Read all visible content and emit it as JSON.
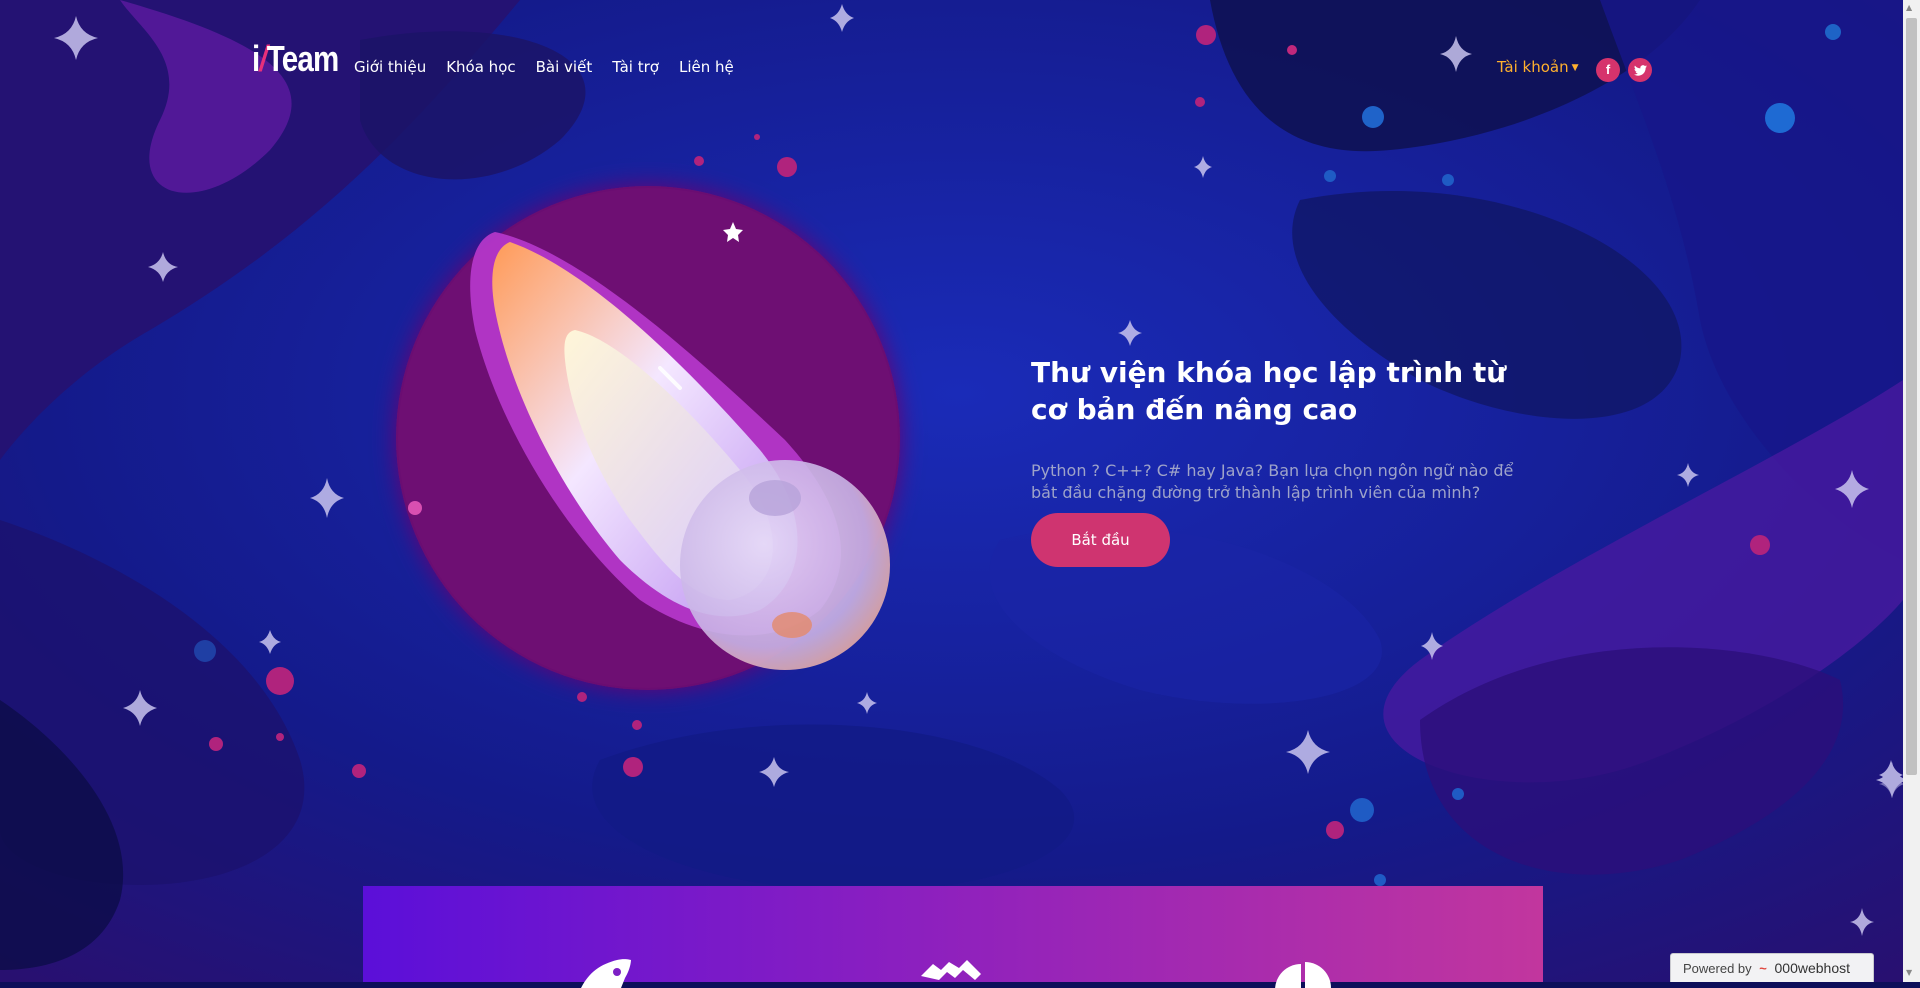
{
  "brand": {
    "logo_left": "i",
    "logo_slash": "/",
    "logo_right": "Team"
  },
  "nav": {
    "items": [
      {
        "label": "Giới thiệu"
      },
      {
        "label": "Khóa học"
      },
      {
        "label": "Bài viết"
      },
      {
        "label": "Tài trợ"
      },
      {
        "label": "Liên hệ"
      }
    ],
    "account_label": "Tài khoản",
    "social": {
      "facebook": "f",
      "twitter": "t"
    }
  },
  "hero": {
    "title": "Thư viện khóa học lập trình từ cơ bản đến nâng cao",
    "subtitle": "Python ? C++? C# hay Java? Bạn lựa chọn ngôn ngữ nào để bắt đầu chặng đường trở thành lập trình viên của mình?",
    "button_label": "Bắt đầu"
  },
  "features": {
    "icons": [
      "rocket-icon",
      "handshake-icon",
      "pie-chart-icon"
    ]
  },
  "footer_badge": {
    "prefix": "Powered by",
    "brand": "000webhost"
  },
  "colors": {
    "accent": "#cf3470",
    "account": "#ffb02e",
    "background": "#0d0f5a",
    "panel_start": "#5b0fd9",
    "panel_end": "#c2369e"
  }
}
